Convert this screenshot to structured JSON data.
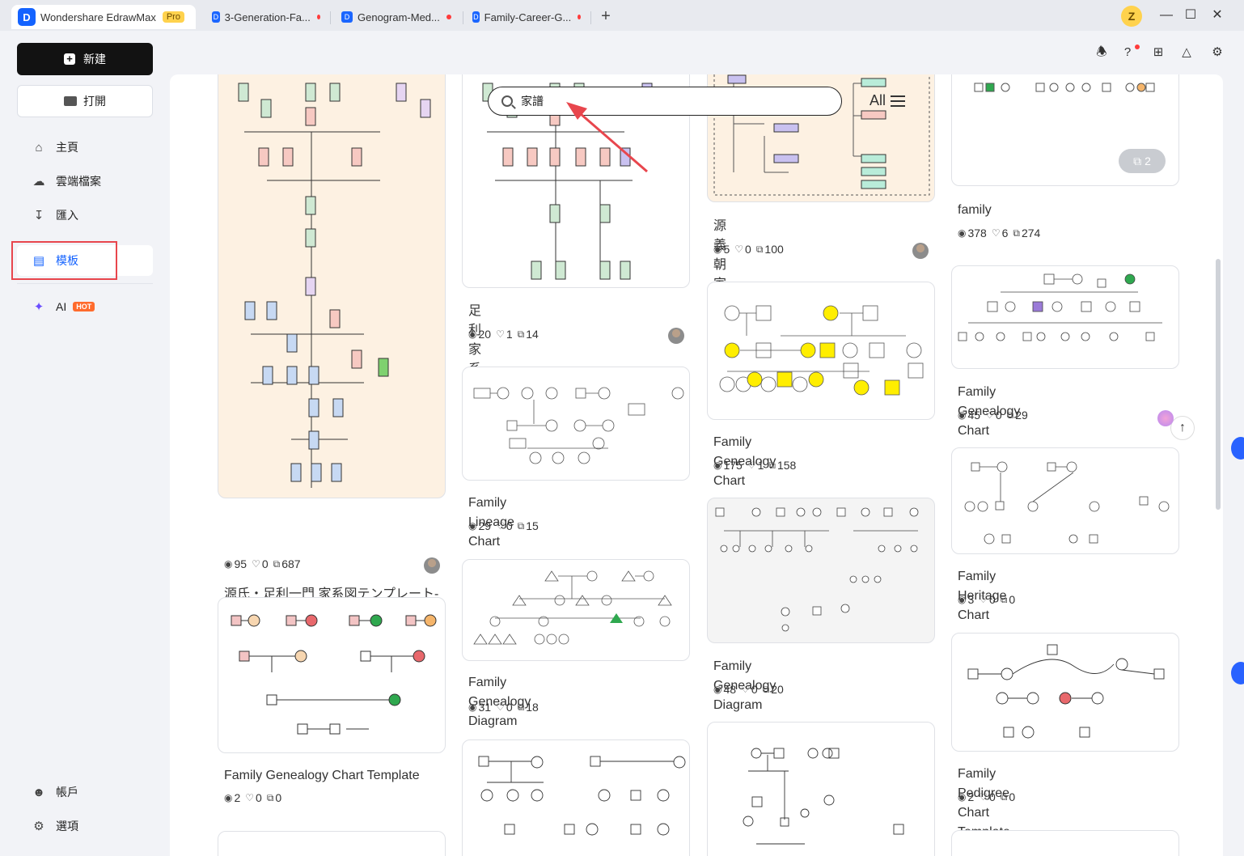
{
  "titlebar": {
    "app_name": "Wondershare EdrawMax",
    "pro_badge": "Pro",
    "tabs": [
      {
        "label": "3-Generation-Fa..."
      },
      {
        "label": "Genogram-Med..."
      },
      {
        "label": "Family-Career-G..."
      }
    ],
    "new_tab": "+",
    "user_initial": "Z",
    "minimize": "—",
    "maximize": "☐",
    "close": "✕"
  },
  "sidebar": {
    "new_label": "新建",
    "open_label": "打開",
    "items": [
      {
        "label": "主頁",
        "icon": "home-icon"
      },
      {
        "label": "雲端檔案",
        "icon": "cloud-icon"
      },
      {
        "label": "匯入",
        "icon": "import-icon"
      },
      {
        "label": "模板",
        "icon": "template-icon"
      },
      {
        "label": "AI",
        "icon": "ai-sparkle-icon"
      }
    ],
    "hot_badge": "HOT",
    "account_label": "帳戶",
    "settings_label": "選項"
  },
  "search": {
    "value": "家譜",
    "filter_label": "All"
  },
  "cards": [
    {
      "title": "源氏・足利一門 家系図テンプレート-日本歴史人物系譜図",
      "views": "95",
      "likes": "0",
      "copies": "687"
    },
    {
      "title": "Family Genealogy Chart Template",
      "views": "2",
      "likes": "0",
      "copies": "0"
    },
    {
      "title": "足利家系図",
      "views": "20",
      "likes": "1",
      "copies": "14"
    },
    {
      "title": "Family Lineage Chart",
      "views": "29",
      "likes": "0",
      "copies": "15"
    },
    {
      "title": "Family Genealogy Diagram",
      "views": "31",
      "likes": "0",
      "copies": "18"
    },
    {
      "title": "源義朝 家系図",
      "views": "5",
      "likes": "0",
      "copies": "100"
    },
    {
      "title": "Family Genealogy Chart",
      "views": "175",
      "likes": "1",
      "copies": "158"
    },
    {
      "title": "Family Genealogy Diagram",
      "views": "48",
      "likes": "0",
      "copies": "20"
    },
    {
      "title": "family",
      "views": "378",
      "likes": "6",
      "copies": "274"
    },
    {
      "title": "Family Genealogy Chart",
      "views": "45",
      "likes": "0",
      "copies": "29"
    },
    {
      "title": "Family Heritage Chart",
      "views": "3",
      "likes": "0",
      "copies": "0"
    },
    {
      "title": "Family Pedigree Chart Template",
      "views": "2",
      "likes": "0",
      "copies": "0"
    }
  ],
  "page_count_badge": "2",
  "colors": {
    "accent": "#1463ff",
    "highlight": "#e8464d",
    "new_button": "#121212",
    "pro": "#ffd24d"
  }
}
